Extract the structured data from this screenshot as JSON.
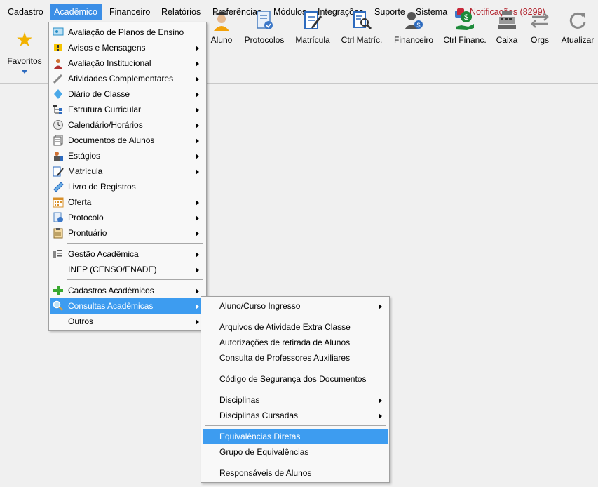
{
  "menubar": {
    "items": [
      "Cadastro",
      "Acadêmico",
      "Financeiro",
      "Relatórios",
      "Preferências",
      "Módulos",
      "Integrações",
      "Suporte",
      "Sistema"
    ],
    "notifications": "Notificações (8299)"
  },
  "toolbar": {
    "favorites": "Favoritos",
    "buttons": [
      "Aluno",
      "Protocolos",
      "Matrícula",
      "Ctrl Matríc.",
      "Financeiro",
      "Ctrl Financ.",
      "Caixa",
      "Orgs",
      "Atualizar"
    ]
  },
  "academico_menu": {
    "items": [
      "Avaliação de Planos de Ensino",
      "Avisos e Mensagens",
      "Avaliação Institucional",
      "Atividades Complementares",
      "Diário de Classe",
      "Estrutura Curricular",
      "Calendário/Horários",
      "Documentos de Alunos",
      "Estágios",
      "Matrícula",
      "Livro de Registros",
      "Oferta",
      "Protocolo",
      "Prontuário",
      "Gestão Acadêmica",
      "INEP (CENSO/ENADE)",
      "Cadastros Acadêmicos",
      "Consultas Acadêmicas",
      "Outros"
    ]
  },
  "consultas_menu": {
    "items": [
      "Aluno/Curso Ingresso",
      "Arquivos de Atividade Extra Classe",
      "Autorizações de retirada de Alunos",
      "Consulta de Professores Auxiliares",
      "Código de Segurança dos Documentos",
      "Disciplinas",
      "Disciplinas Cursadas",
      "Equivalências Diretas",
      "Grupo de Equivalências",
      "Responsáveis de Alunos"
    ]
  },
  "colors": {
    "selection": "#3d9cf0",
    "menubar_active": "#3b8ee6",
    "notification_text": "#b0202a"
  }
}
